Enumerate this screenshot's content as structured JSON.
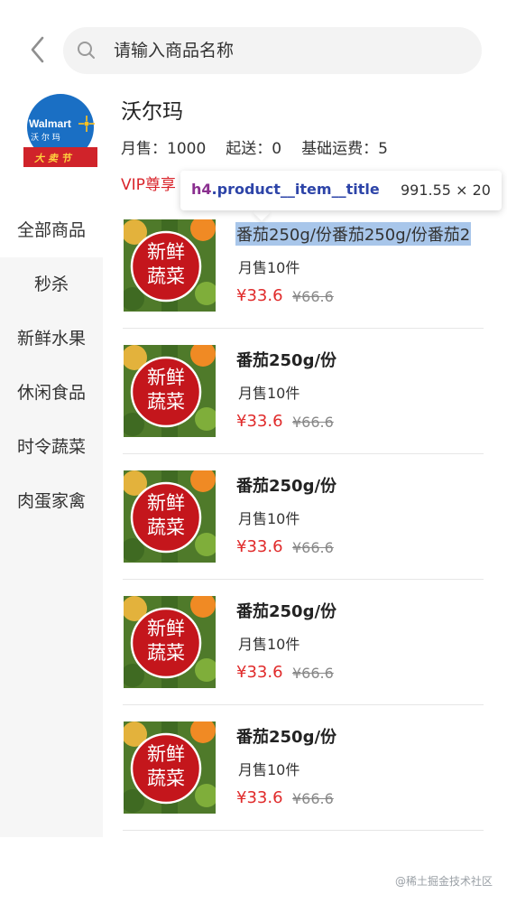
{
  "header": {
    "search_placeholder": "请输入商品名称"
  },
  "shop": {
    "name": "沃尔玛",
    "monthly_sales": "月售：1000",
    "min_delivery": "起送：0",
    "base_shipping": "基础运费：5",
    "vip": "VIP尊享",
    "logo_text": "Walmart",
    "logo_subtext": "沃尔玛"
  },
  "devtools_tooltip": {
    "tag": "h4",
    "class_name": ".product__item__title",
    "size": "991.55 × 20"
  },
  "categories": [
    {
      "label": "全部商品",
      "active": true
    },
    {
      "label": "秒杀",
      "active": false
    },
    {
      "label": "新鲜水果",
      "active": false
    },
    {
      "label": "休闲食品",
      "active": false
    },
    {
      "label": "时令蔬菜",
      "active": false
    },
    {
      "label": "肉蛋家禽",
      "active": false
    }
  ],
  "products": [
    {
      "title": "番茄250g/份番茄250g/份番茄2",
      "sold": "月售10件",
      "price": "¥33.6",
      "old_price": "¥66.6",
      "badge_line1": "新鲜",
      "badge_line2": "蔬菜"
    },
    {
      "title": "番茄250g/份",
      "sold": "月售10件",
      "price": "¥33.6",
      "old_price": "¥66.6",
      "badge_line1": "新鲜",
      "badge_line2": "蔬菜"
    },
    {
      "title": "番茄250g/份",
      "sold": "月售10件",
      "price": "¥33.6",
      "old_price": "¥66.6",
      "badge_line1": "新鲜",
      "badge_line2": "蔬菜"
    },
    {
      "title": "番茄250g/份",
      "sold": "月售10件",
      "price": "¥33.6",
      "old_price": "¥66.6",
      "badge_line1": "新鲜",
      "badge_line2": "蔬菜"
    },
    {
      "title": "番茄250g/份",
      "sold": "月售10件",
      "price": "¥33.6",
      "old_price": "¥66.6",
      "badge_line1": "新鲜",
      "badge_line2": "蔬菜"
    }
  ],
  "watermark": "@稀土掘金技术社区",
  "colors": {
    "accent_red": "#e02b2b",
    "vip_red": "#d9242b",
    "highlight": "#a8c6ea",
    "sidebar_bg": "#f6f6f6",
    "badge_red": "#c4161c"
  },
  "icons": {
    "back": "chevron-left-icon",
    "search": "search-icon"
  }
}
